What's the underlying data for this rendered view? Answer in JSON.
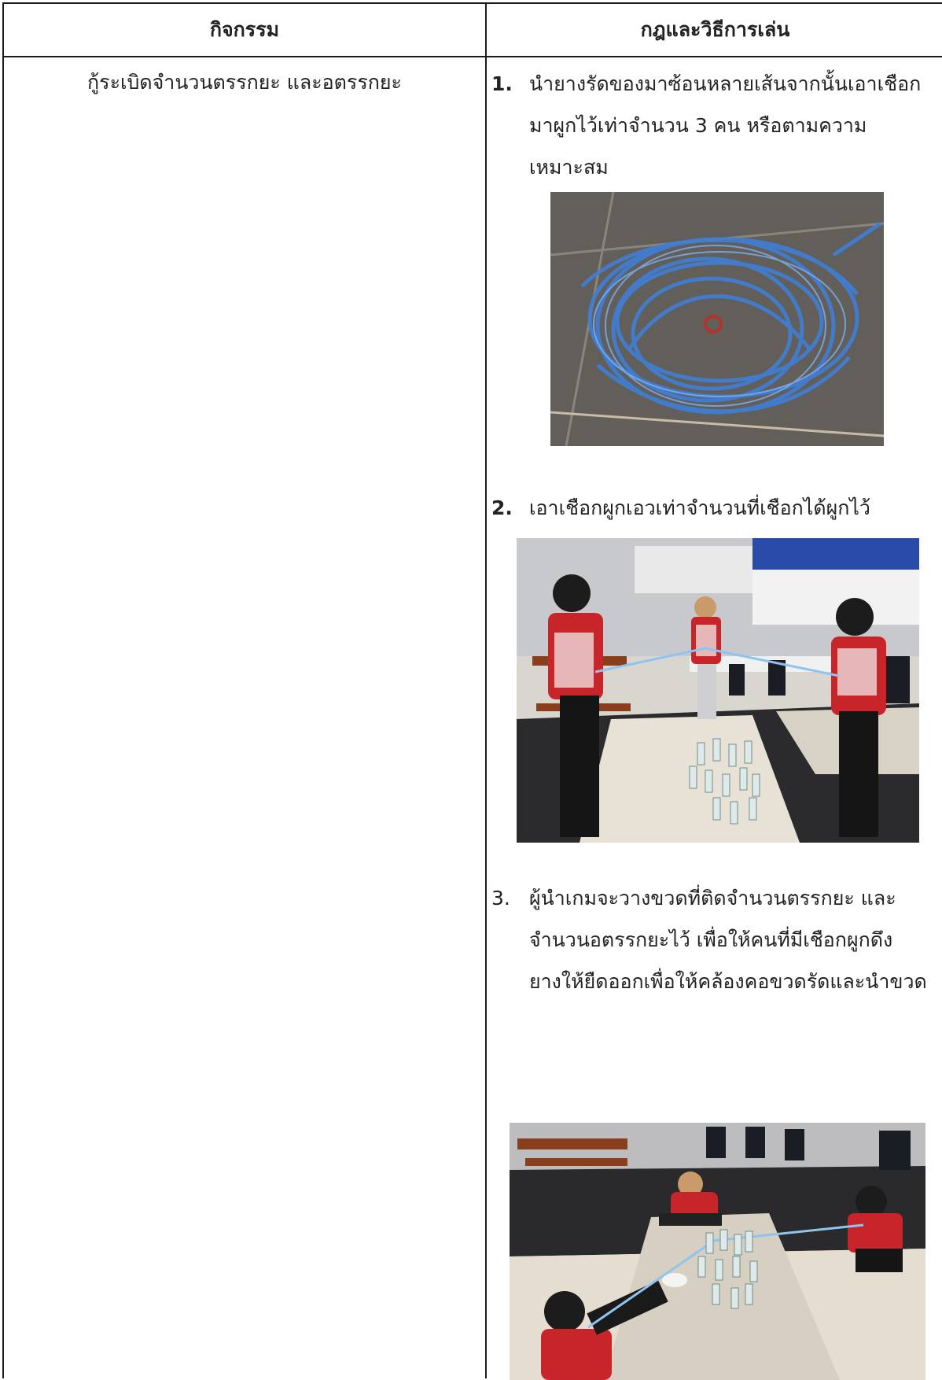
{
  "table": {
    "headers": [
      "กิจกรรม",
      "กฎและวิธีการเล่น"
    ],
    "activity": "กู้ระเบิดจำนวนตรรกยะ และอตรรกยะ",
    "steps": [
      {
        "num": "1.",
        "lines": [
          "นำยางรัดของมาซ้อนหลายเส้นจากนั้นเอาเชือก",
          "มาผูกไว้เท่าจำนวน 3 คน หรือตามความ",
          "เหมาะสม"
        ]
      },
      {
        "num": "2.",
        "lines": [
          "เอาเชือกผูกเอวเท่าจำนวนที่เชือกได้ผูกไว้"
        ]
      },
      {
        "num": "3.",
        "lines": [
          "ผู้นำเกมจะวางขวดที่ติดจำนวนตรรกยะ และ",
          "จำนวนอตรรกยะไว้ เพื่อให้คนที่มีเชือกผูกดึง",
          "ยางให้ยืดออกเพื่อให้คล้องคอขวดรัดและนำขวด"
        ]
      }
    ]
  }
}
